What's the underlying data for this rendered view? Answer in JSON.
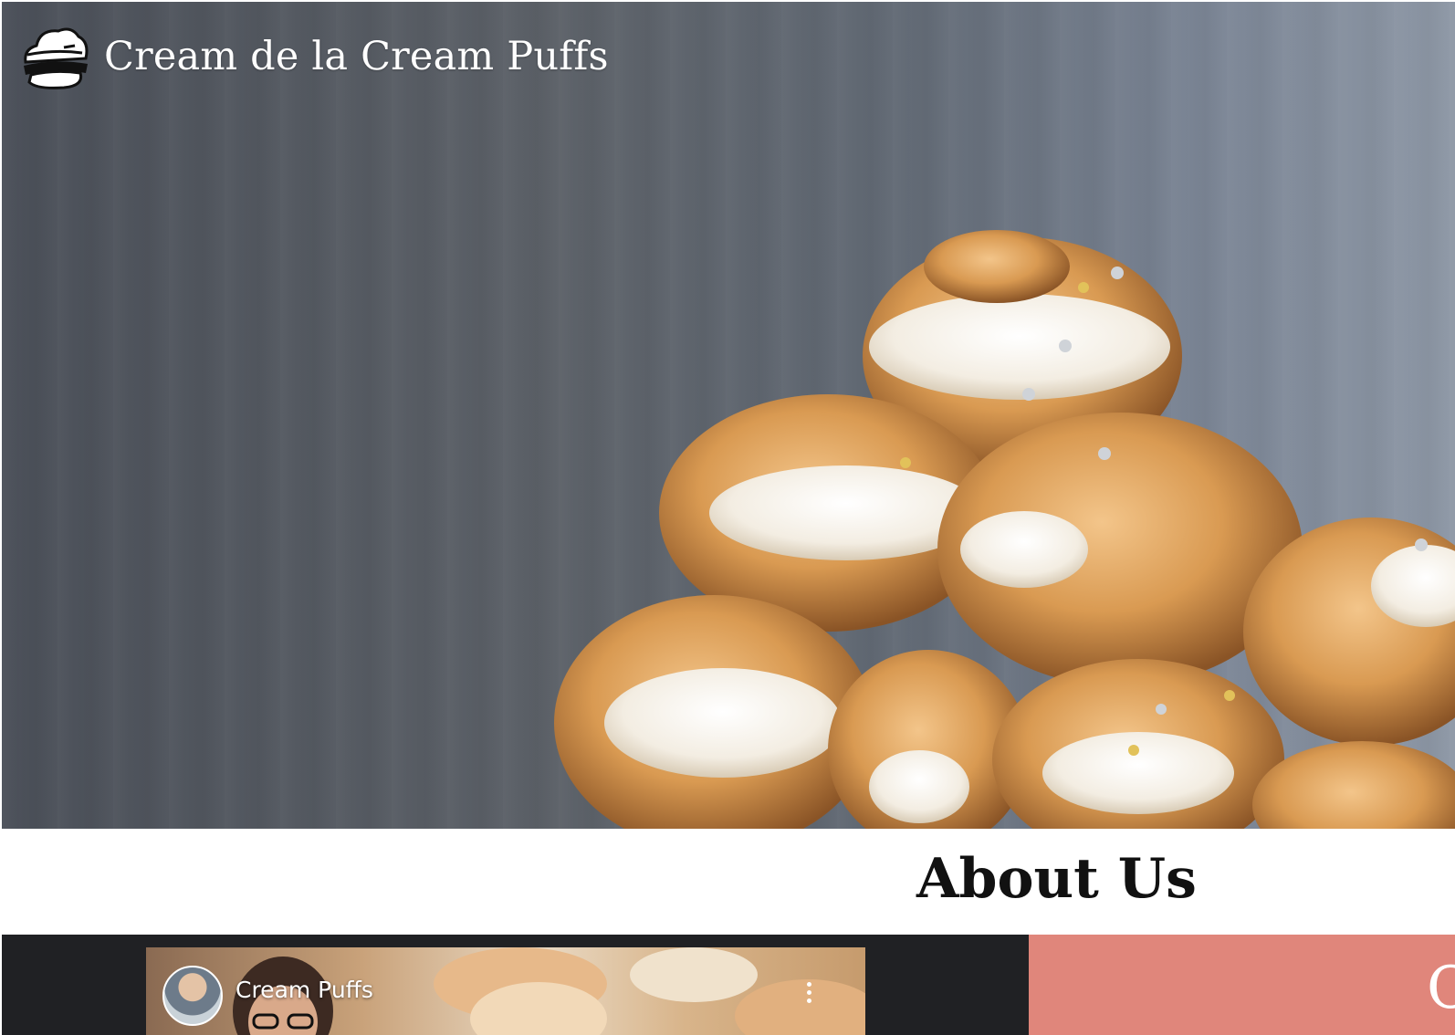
{
  "brand": {
    "name": "Cream de la Cream Puffs",
    "logo_icon": "cream-puff-logo-icon"
  },
  "hero": {
    "image": "cream-puff-tower-photo"
  },
  "about": {
    "title": "About Us"
  },
  "video": {
    "title": "Cream Puffs",
    "avatar_icon": "channel-avatar",
    "menu_icon": "kebab-menu-icon"
  },
  "side_panel": {
    "text": "C",
    "color": "#e0867b"
  },
  "colors": {
    "hero_background": "#5c6168",
    "video_band": "#202124",
    "accent": "#e0867b"
  }
}
